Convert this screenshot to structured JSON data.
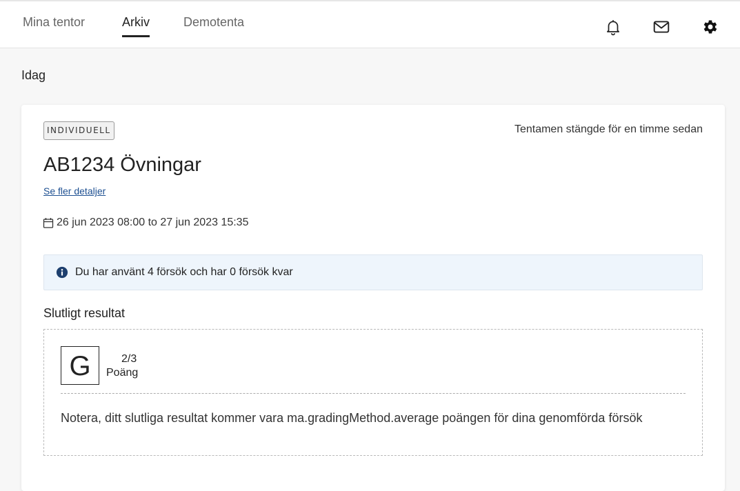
{
  "nav": {
    "tabs": [
      {
        "label": "Mina tentor"
      },
      {
        "label": "Arkiv",
        "active": true
      },
      {
        "label": "Demotenta"
      }
    ],
    "icons": [
      "bell-icon",
      "mail-icon",
      "gear-icon"
    ]
  },
  "section": {
    "title": "Idag"
  },
  "exam": {
    "badge": "INDIVIDUELL",
    "status": "Tentamen stängde för en timme sedan",
    "title": "AB1234 Övningar",
    "details_link": "Se fler detaljer",
    "date_range": "26 jun 2023 08:00 to 27 jun 2023 15:35",
    "attempts_info": "Du har använt 4 försök och har 0 försök kvar"
  },
  "result": {
    "heading": "Slutligt resultat",
    "grade": "G",
    "score": "2/3",
    "score_label": "Poäng",
    "note": "Notera, ditt slutliga resultat kommer vara ma.gradingMethod.average poängen för dina genomförda försök"
  },
  "colors": {
    "link": "#1d4f91",
    "info_bg": "#eef5fc",
    "info_icon": "#1d3f6e"
  }
}
